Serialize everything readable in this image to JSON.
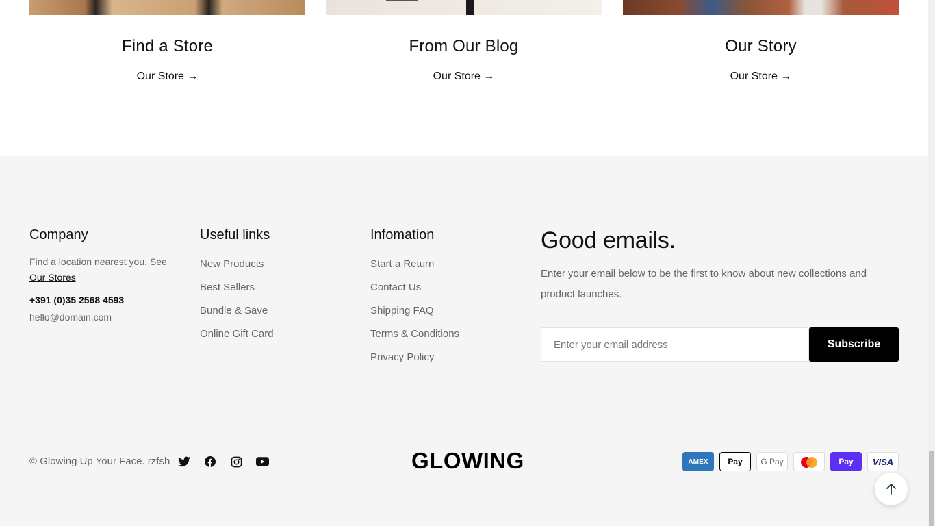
{
  "cards": [
    {
      "title": "Find a Store",
      "link": "Our Store →"
    },
    {
      "title": "From Our Blog",
      "link": "Our Store →"
    },
    {
      "title": "Our Story",
      "link": "Our Store →"
    }
  ],
  "footer": {
    "company": {
      "heading": "Company",
      "desc": "Find a location nearest you. See",
      "stores_link": "Our Stores",
      "phone": "+391 (0)35 2568 4593",
      "email": "hello@domain.com"
    },
    "useful_links": {
      "heading": "Useful links",
      "items": [
        "New Products",
        "Best Sellers",
        "Bundle & Save",
        "Online Gift Card"
      ]
    },
    "information": {
      "heading": "Infomation",
      "items": [
        "Start a Return",
        "Contact Us",
        "Shipping FAQ",
        "Terms & Conditions",
        "Privacy Policy"
      ]
    },
    "newsletter": {
      "heading": "Good emails.",
      "text": "Enter your email below to be the first to know about new collections and product launches.",
      "placeholder": "Enter your email address",
      "button": "Subscribe"
    },
    "bottom": {
      "copyright": "© Glowing Up Your Face. rzfsh",
      "logo": "GLOWING",
      "socials": [
        "twitter-icon",
        "facebook-icon",
        "instagram-icon",
        "youtube-icon"
      ],
      "payments": {
        "amex": "AMEX",
        "apple": " Pay",
        "gpay": "G Pay",
        "shop": "Pay",
        "visa": "VISA"
      }
    }
  }
}
